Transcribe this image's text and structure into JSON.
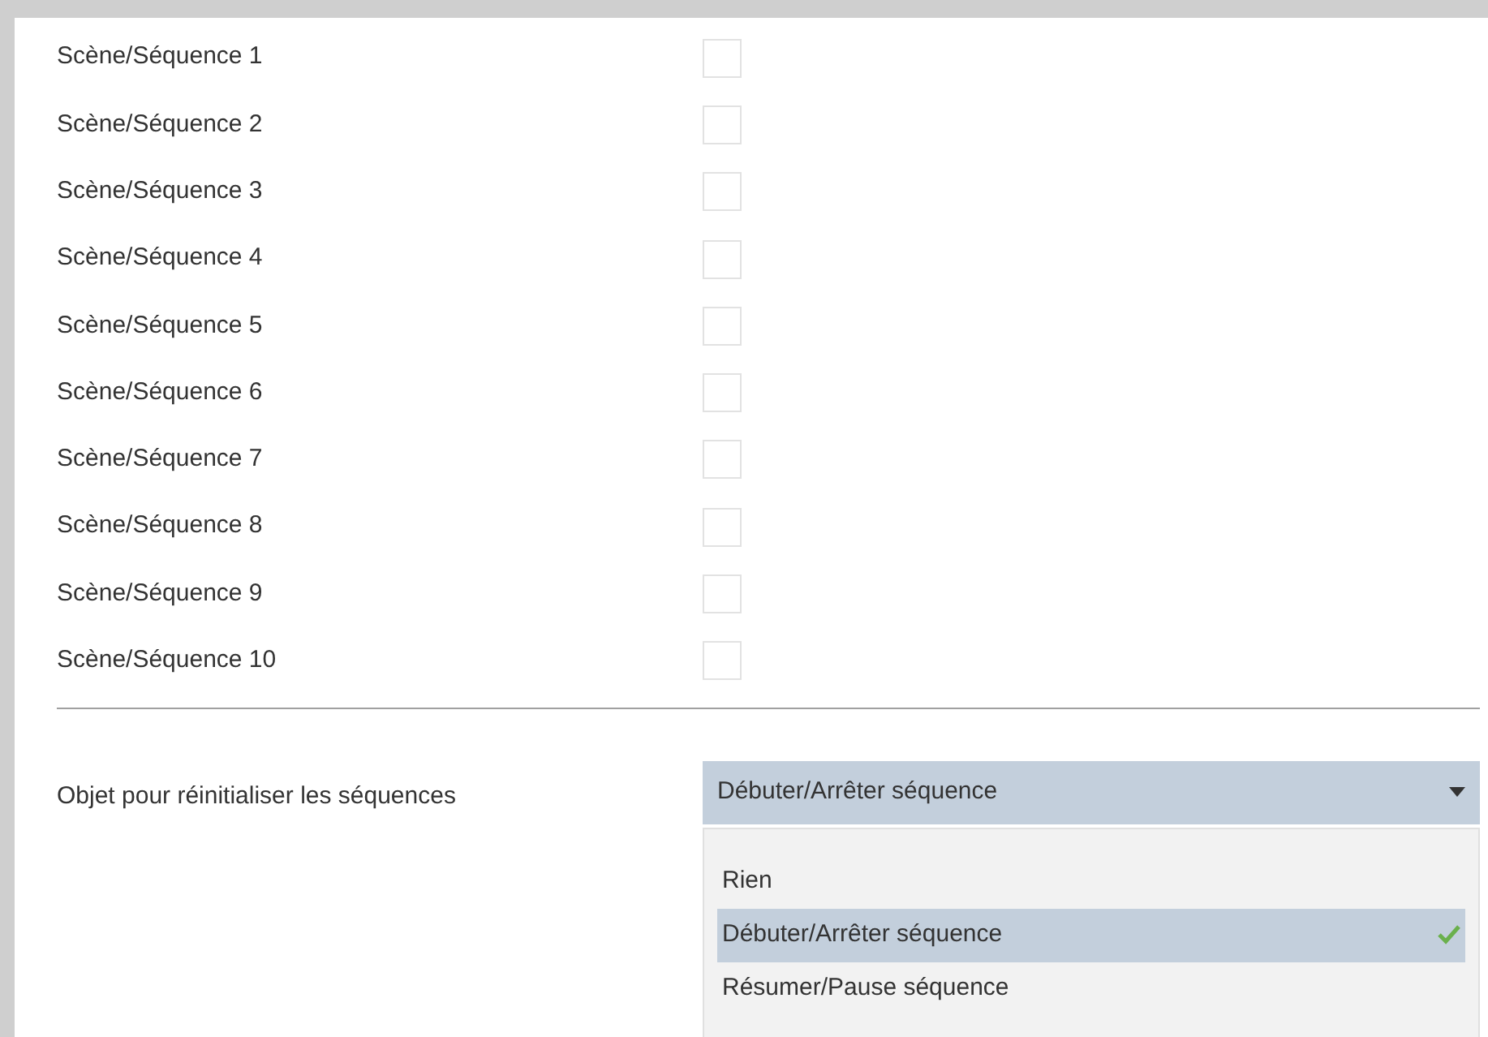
{
  "items": [
    {
      "label": "Scène/Séquence 1",
      "checked": false
    },
    {
      "label": "Scène/Séquence 2",
      "checked": false
    },
    {
      "label": "Scène/Séquence 3",
      "checked": false
    },
    {
      "label": "Scène/Séquence 4",
      "checked": false
    },
    {
      "label": "Scène/Séquence 5",
      "checked": false
    },
    {
      "label": "Scène/Séquence 6",
      "checked": false
    },
    {
      "label": "Scène/Séquence 7",
      "checked": false
    },
    {
      "label": "Scène/Séquence 8",
      "checked": false
    },
    {
      "label": "Scène/Séquence 9",
      "checked": false
    },
    {
      "label": "Scène/Séquence 10",
      "checked": false
    }
  ],
  "reset_object": {
    "label": "Objet pour réinitialiser les séquences",
    "value": "Débuter/Arrêter séquence",
    "expanded": true,
    "options": [
      {
        "label": "Rien",
        "selected": false
      },
      {
        "label": "Débuter/Arrêter séquence",
        "selected": true
      },
      {
        "label": "Résumer/Pause séquence",
        "selected": false
      }
    ]
  }
}
